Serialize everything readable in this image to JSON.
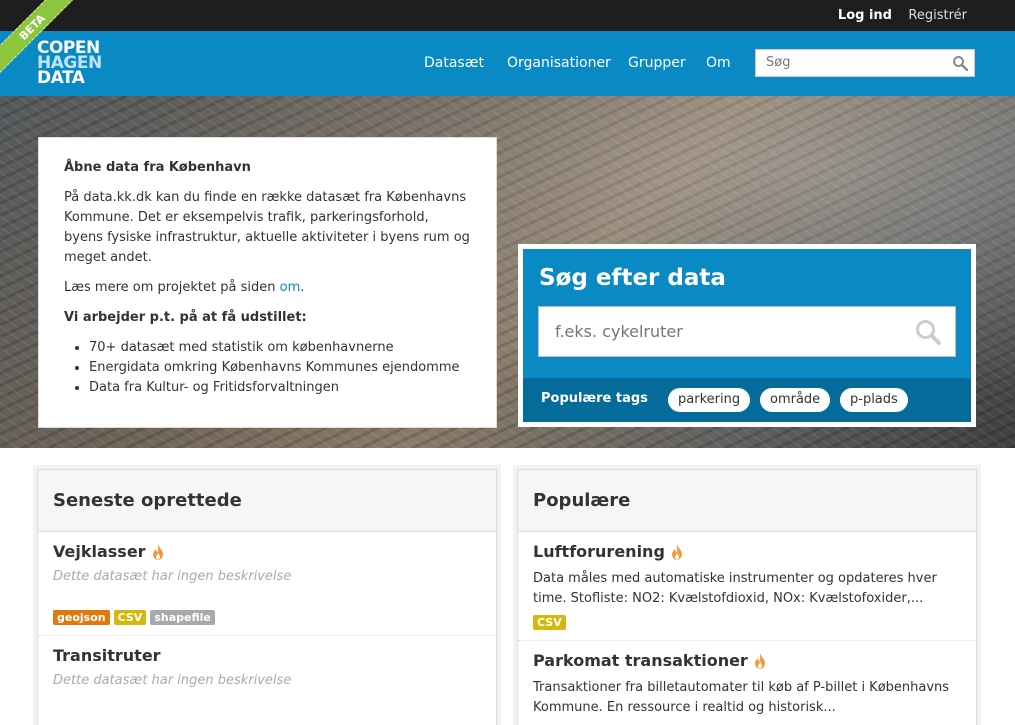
{
  "beta": "BETA",
  "account": {
    "login": "Log ind",
    "register": "Registrér"
  },
  "logo": {
    "line1": "COPEN",
    "line2": "HAGEN",
    "line3": "DATA"
  },
  "nav": [
    "Datasæt",
    "Organisationer",
    "Grupper",
    "Om"
  ],
  "site_search": {
    "placeholder": "Søg"
  },
  "intro": {
    "title": "Åbne data fra København",
    "para1": "På data.kk.dk kan du finde en række datasæt fra Københavns Kommune. Det er eksempelvis trafik, parkeringsforhold, byens fysiske infrastruktur, aktuelle aktiviteter i byens rum og meget andet.",
    "para2_pre": "Læs mere om projektet på siden ",
    "para2_link": "om",
    "para2_post": ".",
    "working_heading": "Vi arbejder p.t. på at få udstillet:",
    "items": [
      "70+ datasæt med statistik om københavnerne",
      "Energidata omkring Københavns Kommunes ejendomme",
      "Data fra Kultur- og Fritidsforvaltningen"
    ]
  },
  "search_panel": {
    "title": "Søg efter data",
    "placeholder": "f.eks. cykelruter",
    "tags_label": "Populære tags",
    "tags": [
      "parkering",
      "område",
      "p-plads"
    ]
  },
  "recent": {
    "title": "Seneste oprettede",
    "items": [
      {
        "title": "Vejklasser",
        "desc": "Dette datasæt har ingen beskrivelse",
        "formats": [
          "geojson",
          "CSV",
          "shapefile"
        ]
      },
      {
        "title": "Transitruter",
        "desc": "Dette datasæt har ingen beskrivelse",
        "formats": []
      }
    ]
  },
  "popular": {
    "title": "Populære",
    "items": [
      {
        "title": "Luftforurening",
        "text": "Data måles med automatiske instrumenter og opdateres hver time. Stofliste: NO2: Kvælstofdioxid, NOx: Kvælstofoxider,...",
        "formats": [
          "CSV"
        ]
      },
      {
        "title": "Parkomat transaktioner",
        "text": "Transaktioner fra billetautomater til køb af P-billet i Københavns Kommune. En ressource i realtid og historisk...",
        "formats": []
      }
    ]
  },
  "colors": {
    "brand": "#0a8ac4",
    "geojson": "#e07a10",
    "csv": "#d4b90c",
    "shapefile": "#a9a9a9"
  }
}
